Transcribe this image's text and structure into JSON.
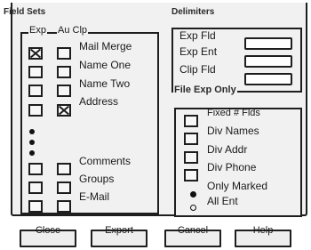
{
  "field_sets": {
    "title": "Field Sets",
    "col_exp": "Exp",
    "col_au_clp": "Au Clp",
    "items": [
      {
        "label": "Mail Merge",
        "exp": true,
        "au": false
      },
      {
        "label": "Name One",
        "exp": false,
        "au": false
      },
      {
        "label": "Name Two",
        "exp": false,
        "au": false
      },
      {
        "label": "Address",
        "exp": false,
        "au": true
      },
      {
        "label": "Comments",
        "exp": false,
        "au": false
      },
      {
        "label": "Groups",
        "exp": false,
        "au": false
      },
      {
        "label": "E-Mail",
        "exp": false,
        "au": false
      }
    ]
  },
  "delimiters": {
    "title": "Delimiters",
    "exp_fld": "Exp Fld",
    "exp_ent": "Exp Ent",
    "clip_fld": "Clip Fld"
  },
  "file_exp_only": {
    "title": "File Exp Only",
    "fixed_flds": "Fixed # Flds",
    "div_names": "Div Names",
    "div_addr": "Div Addr",
    "div_phone": "Div Phone",
    "only_marked": "Only Marked",
    "all_ent": "All Ent",
    "selected": "only_marked"
  },
  "buttons": {
    "close": "Close",
    "export": "Export",
    "cancel": "Cancel",
    "help": "Help"
  }
}
